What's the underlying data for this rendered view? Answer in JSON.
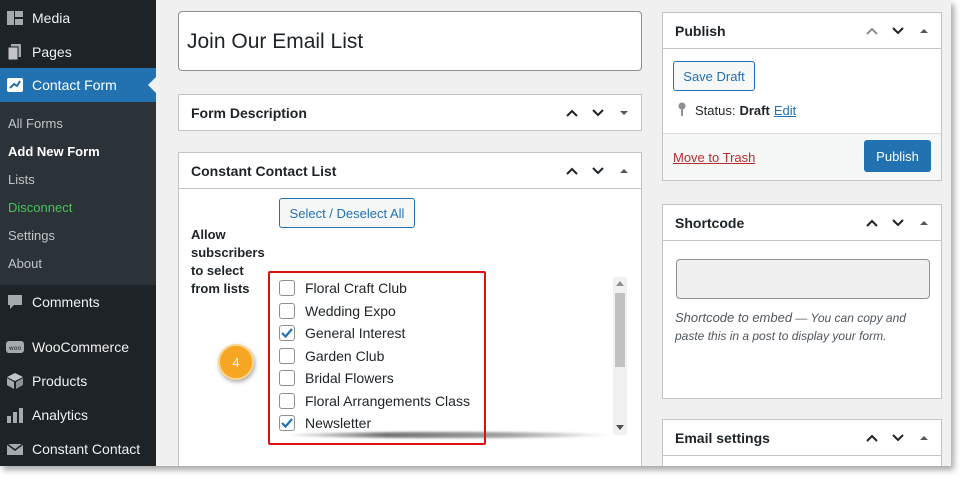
{
  "sidebar": {
    "top_items": [
      {
        "label": "Media",
        "icon": "media-icon"
      },
      {
        "label": "Pages",
        "icon": "pages-icon"
      },
      {
        "label": "Contact Form",
        "icon": "contact-form-icon"
      }
    ],
    "submenu": [
      {
        "label": "All Forms"
      },
      {
        "label": "Add New Form"
      },
      {
        "label": "Lists"
      },
      {
        "label": "Disconnect"
      },
      {
        "label": "Settings"
      },
      {
        "label": "About"
      }
    ],
    "bottom_items": [
      {
        "label": "Comments",
        "icon": "comments-icon"
      },
      {
        "label": "WooCommerce",
        "icon": "woocommerce-icon"
      },
      {
        "label": "Products",
        "icon": "products-icon"
      },
      {
        "label": "Analytics",
        "icon": "analytics-icon"
      },
      {
        "label": "Constant Contact",
        "icon": "mail-icon"
      }
    ],
    "active_color": "#2271b1",
    "disconnect_color": "#46c45c"
  },
  "editor": {
    "title": "Join Our Email List",
    "form_description": {
      "heading": "Form Description"
    },
    "contact_list": {
      "heading": "Constant Contact List",
      "allow_label": "Allow subscribers to select from lists",
      "select_all_label": "Select / Deselect All",
      "lists": [
        {
          "label": "Floral Craft Club",
          "checked": false
        },
        {
          "label": "Wedding Expo",
          "checked": false
        },
        {
          "label": "General Interest",
          "checked": true
        },
        {
          "label": "Garden Club",
          "checked": false
        },
        {
          "label": "Bridal Flowers",
          "checked": false
        },
        {
          "label": "Floral Arrangements Class",
          "checked": false
        },
        {
          "label": "Newsletter",
          "checked": true
        }
      ]
    },
    "callout_number": "4",
    "highlight_color": "#dd1111",
    "callout_color": "#f6a623"
  },
  "publish": {
    "heading": "Publish",
    "save_draft_label": "Save Draft",
    "status_label": "Status:",
    "status_value": "Draft",
    "status_edit": "Edit",
    "trash_label": "Move to Trash",
    "publish_label": "Publish"
  },
  "shortcode": {
    "heading": "Shortcode",
    "value": "",
    "desc_em": "Shortcode to embed",
    "desc_rest": " — You can copy and paste this in a post to display your form."
  },
  "email_settings": {
    "heading": "Email settings"
  }
}
